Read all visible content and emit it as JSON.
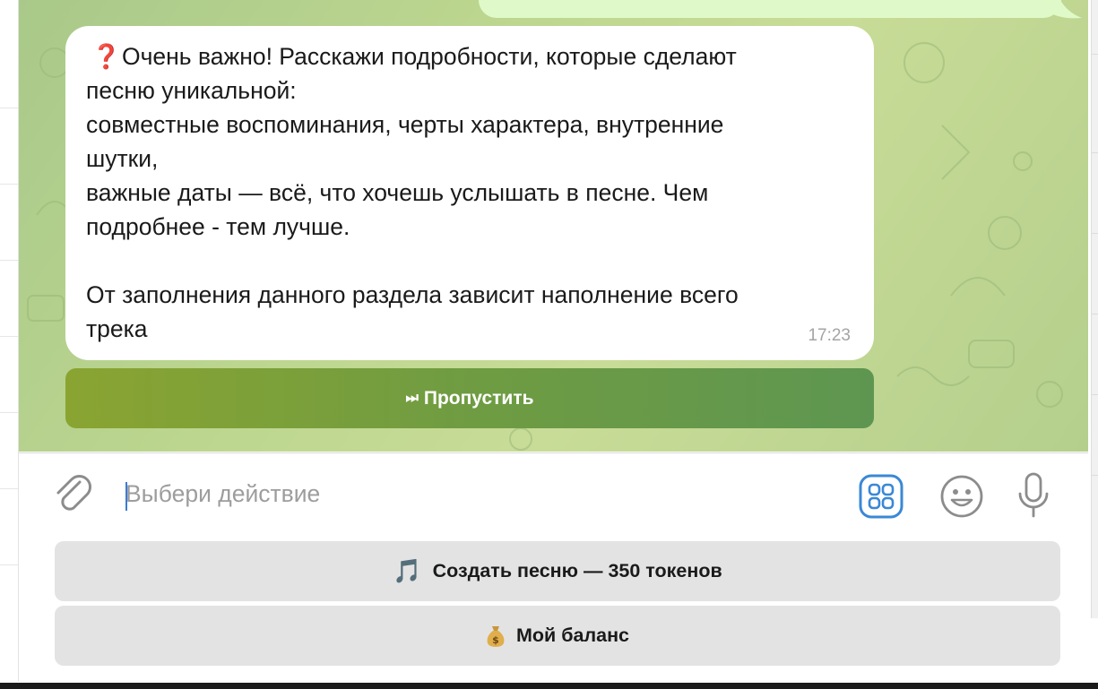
{
  "incoming_message": {
    "lines": [
      {
        "icon": "❓",
        "text": "Очень важно! Расскажи подробности, которые сделают"
      },
      {
        "text": "песню уникальной:"
      },
      {
        "text": "совместные воспоминания, черты характера, внутренние"
      },
      {
        "text": "шутки,"
      },
      {
        "text": "важные даты — всё, что хочешь услышать в песне. Чем"
      },
      {
        "text": "подробнее - тем лучше."
      },
      {
        "text": ""
      },
      {
        "text": "От заполнения данного раздела зависит наполнение всего"
      },
      {
        "text": "трека"
      }
    ],
    "time": "17:23"
  },
  "inline_button": {
    "glyph": "⏭",
    "label": "Пропустить"
  },
  "composer": {
    "placeholder": "Выбери действие",
    "icons": [
      "paperclip-icon",
      "bot-commands-icon",
      "emoji-icon",
      "microphone-icon"
    ]
  },
  "keyboard": {
    "buttons": [
      {
        "emoji": "🎵",
        "label": "Создать песню — 350 токенов"
      },
      {
        "emoji": "💰",
        "label": "Мой баланс"
      }
    ]
  },
  "colors": {
    "chat_bg": "#bcd68f",
    "inline_button": "#6f9c42",
    "accent_blue": "#3a7bd5",
    "keyboard_button": "#e3e3e3"
  }
}
